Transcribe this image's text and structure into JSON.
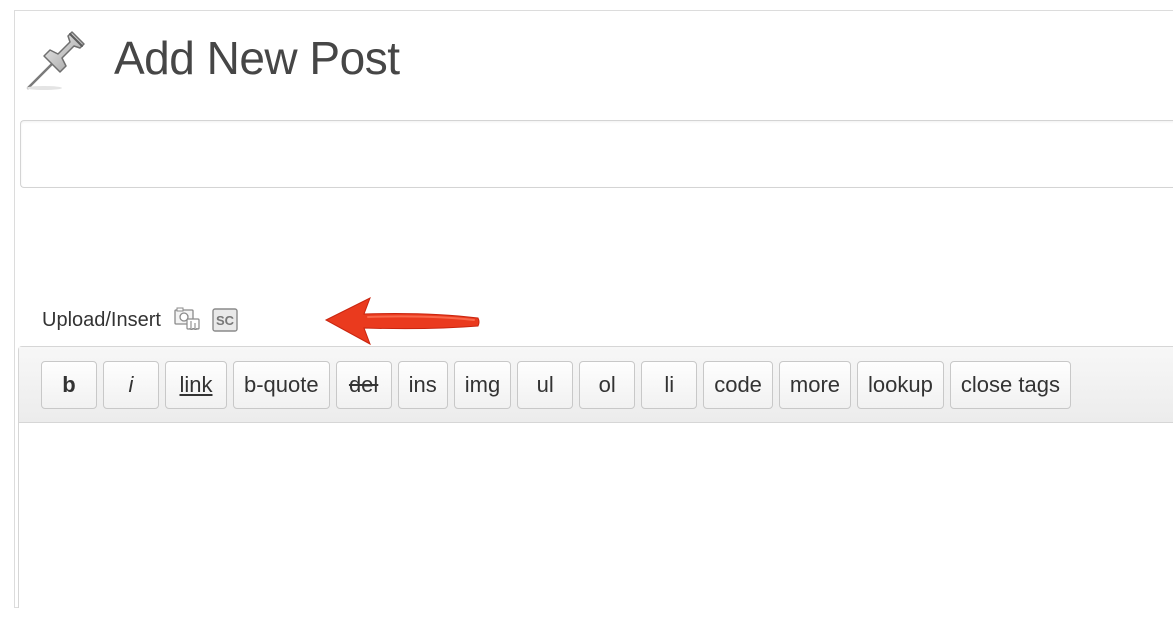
{
  "header": {
    "title": "Add New Post",
    "icon": "pushpin-icon"
  },
  "title_field": {
    "value": "",
    "placeholder": ""
  },
  "media": {
    "label": "Upload/Insert",
    "icons": [
      "add-media-icon",
      "shortcode-icon"
    ]
  },
  "annotation": {
    "arrow_color": "#e8341b"
  },
  "toolbar": {
    "buttons": [
      "b",
      "i",
      "link",
      "b-quote",
      "del",
      "ins",
      "img",
      "ul",
      "ol",
      "li",
      "code",
      "more",
      "lookup",
      "close tags"
    ]
  },
  "content": {
    "value": ""
  }
}
